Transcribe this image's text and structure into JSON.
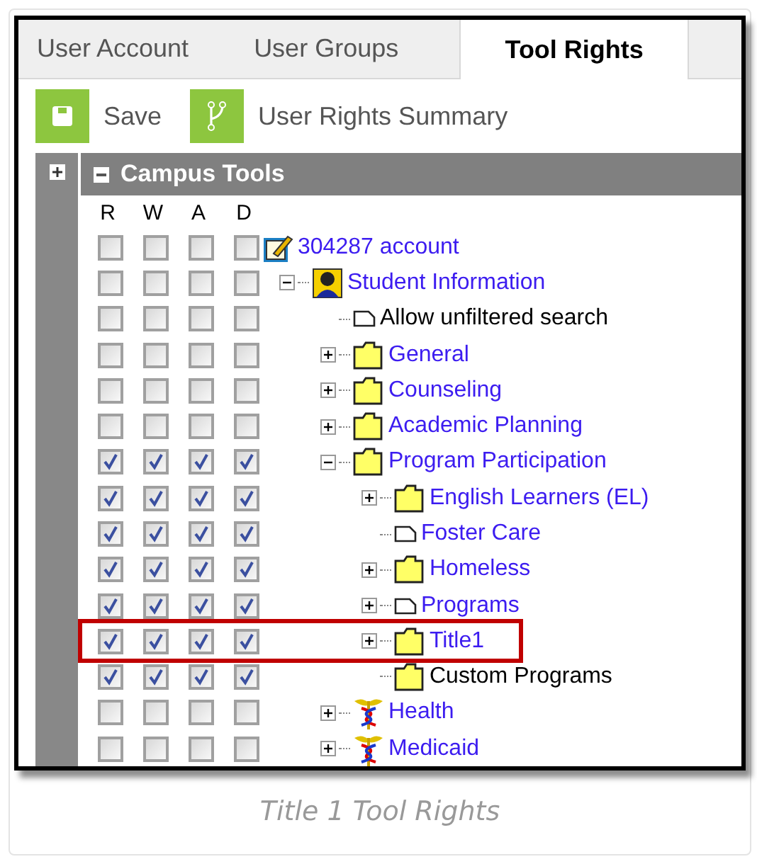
{
  "tabs": [
    {
      "label": "User Account",
      "selected": false
    },
    {
      "label": "User Groups",
      "selected": false
    },
    {
      "label": "Tool Rights",
      "selected": true
    }
  ],
  "toolbar": [
    {
      "label": "Save",
      "kind": "save"
    },
    {
      "label": "User Rights Summary",
      "kind": "summary"
    }
  ],
  "panel": {
    "title": "Campus Tools",
    "expanded": true
  },
  "columns": [
    "R",
    "W",
    "A",
    "D"
  ],
  "tree": [
    {
      "label": "304287 account",
      "kind": "account",
      "link": true,
      "checked": [
        false,
        false,
        false,
        false
      ],
      "children": [
        {
          "label": "Student Information",
          "kind": "person",
          "link": true,
          "expanded": true,
          "checked": [
            false,
            false,
            false,
            false
          ],
          "children": [
            {
              "label": "Allow unfiltered search",
              "kind": "page",
              "link": false,
              "checked": [
                false,
                false,
                false,
                false
              ]
            },
            {
              "label": "General",
              "kind": "folder",
              "link": true,
              "expanded": false,
              "checked": [
                false,
                false,
                false,
                false
              ]
            },
            {
              "label": "Counseling",
              "kind": "folder",
              "link": true,
              "expanded": false,
              "checked": [
                false,
                false,
                false,
                false
              ]
            },
            {
              "label": "Academic Planning",
              "kind": "folder",
              "link": true,
              "expanded": false,
              "checked": [
                false,
                false,
                false,
                false
              ]
            },
            {
              "label": "Program Participation",
              "kind": "folder",
              "link": true,
              "expanded": true,
              "checked": [
                true,
                true,
                true,
                true
              ],
              "children": [
                {
                  "label": "English Learners (EL)",
                  "kind": "folder",
                  "link": true,
                  "expanded": false,
                  "checked": [
                    true,
                    true,
                    true,
                    true
                  ]
                },
                {
                  "label": "Foster Care",
                  "kind": "page",
                  "link": true,
                  "checked": [
                    true,
                    true,
                    true,
                    true
                  ]
                },
                {
                  "label": "Homeless",
                  "kind": "folder",
                  "link": true,
                  "expanded": false,
                  "checked": [
                    true,
                    true,
                    true,
                    true
                  ]
                },
                {
                  "label": "Programs",
                  "kind": "page",
                  "link": true,
                  "expanded": false,
                  "checked": [
                    true,
                    true,
                    true,
                    true
                  ]
                },
                {
                  "label": "Title1",
                  "kind": "folder",
                  "link": true,
                  "expanded": false,
                  "highlighted": true,
                  "checked": [
                    true,
                    true,
                    true,
                    true
                  ]
                },
                {
                  "label": "Custom Programs",
                  "kind": "folder",
                  "link": false,
                  "checked": [
                    true,
                    true,
                    true,
                    true
                  ]
                }
              ]
            },
            {
              "label": "Health",
              "kind": "caduceus",
              "link": true,
              "expanded": false,
              "checked": [
                false,
                false,
                false,
                false
              ]
            },
            {
              "label": "Medicaid",
              "kind": "caduceus",
              "link": true,
              "expanded": false,
              "checked": [
                false,
                false,
                false,
                false
              ]
            }
          ]
        }
      ]
    }
  ],
  "caption": "Title 1 Tool Rights"
}
